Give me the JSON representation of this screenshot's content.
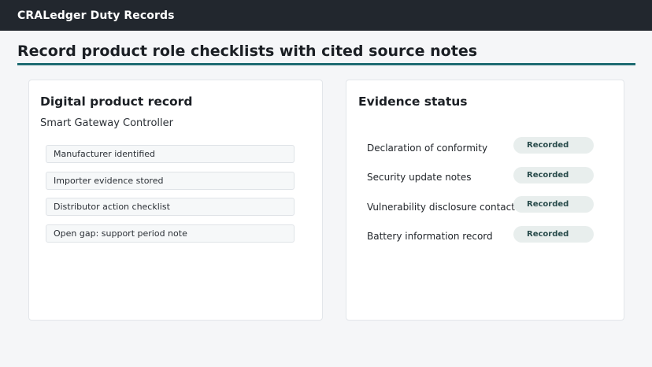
{
  "header": {
    "app_title": "CRALedger Duty Records"
  },
  "page": {
    "title": "Record product role checklists with cited source notes"
  },
  "product_card": {
    "title": "Digital product record",
    "product_name": "Smart Gateway Controller",
    "checklist": [
      "Manufacturer identified",
      "Importer evidence stored",
      "Distributor action checklist",
      "Open gap: support period note"
    ]
  },
  "evidence_card": {
    "title": "Evidence status",
    "items": [
      {
        "label": "Declaration of conformity",
        "status": "Recorded"
      },
      {
        "label": "Security update notes",
        "status": "Recorded"
      },
      {
        "label": "Vulnerability disclosure contact",
        "status": "Recorded"
      },
      {
        "label": "Battery information record",
        "status": "Recorded"
      }
    ]
  },
  "colors": {
    "topbar": "#22272e",
    "accent_rule": "#1f6c72",
    "badge_bg": "#e8eeed",
    "badge_text": "#274a4a"
  }
}
